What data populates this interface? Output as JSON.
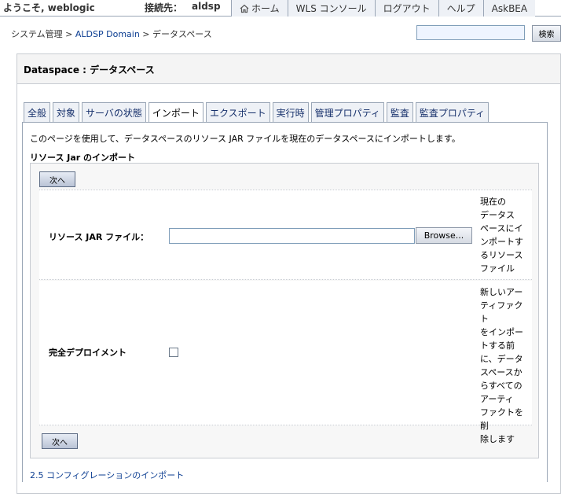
{
  "header": {
    "welcome": "ようこそ, weblogic",
    "connect_label": "接続先：",
    "connect_value": "aldsp",
    "nav": {
      "home": "ホーム",
      "wls_console": "WLS コンソール",
      "logout": "ログアウト",
      "help": "ヘルプ",
      "askbea": "AskBEA"
    }
  },
  "breadcrumb": {
    "system": "システム管理",
    "sep1": " > ",
    "domain": "ALDSP Domain",
    "sep2": " > ",
    "current": "データスペース"
  },
  "search": {
    "value": "",
    "button": "検索"
  },
  "panel": {
    "title": "Dataspace : データスペース"
  },
  "tabs": [
    {
      "label": "全般"
    },
    {
      "label": "対象"
    },
    {
      "label": "サーバの状態"
    },
    {
      "label": "インポート"
    },
    {
      "label": "エクスポート"
    },
    {
      "label": "実行時"
    },
    {
      "label": "管理プロパティ"
    },
    {
      "label": "監査"
    },
    {
      "label": "監査プロパティ"
    }
  ],
  "active_tab": "インポート",
  "content": {
    "intro": "このページを使用して、データスペースのリソース JAR ファイルを現在のデータスペースにインポートします。",
    "section_title": "リソース Jar のインポート",
    "next_label": "次へ",
    "file_field": {
      "label": "リソース JAR ファイル：",
      "value": "",
      "browse": "Browse...",
      "help_lines": [
        "現在の",
        "データス",
        "ペースにイ",
        "ンポートす",
        "るリソース",
        "ファイル"
      ]
    },
    "deploy_field": {
      "label": "完全デプロイメント",
      "checked": false,
      "help_lines": [
        "新しいアー",
        "ティファクト",
        "をインポー",
        "トする前",
        "に、データ",
        "スペースか",
        "らすべての",
        "アーティ",
        "ファクトを削",
        "除します"
      ]
    }
  },
  "footer_link": "2.5 コンフィグレーションのインポート"
}
